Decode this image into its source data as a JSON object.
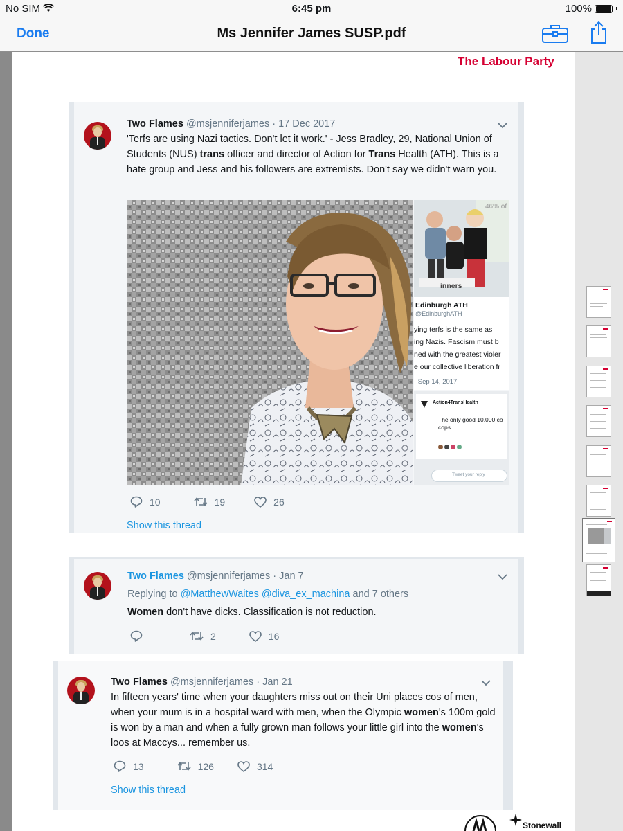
{
  "status": {
    "carrier": "No SIM",
    "time": "6:45 pm",
    "battery": "100%"
  },
  "nav": {
    "done": "Done",
    "title": "Ms Jennifer James SUSP.pdf",
    "tools_icon": "toolbox-icon",
    "share_icon": "share-icon"
  },
  "page": {
    "header": "The Labour Party",
    "footer_stonewall": "Stonewall",
    "footer_badge_icon": "positive-about-people-logo"
  },
  "tweets": [
    {
      "name": "Two Flames",
      "handle": "@msjenniferjames",
      "date": "· 17 Dec 2017",
      "text_parts": [
        "'Terfs are using Nazi tactics. Don't let it work.' - Jess Bradley, 29, National Union of Students (NUS) ",
        "trans",
        " officer and director of Action for ",
        "Trans",
        " Health (ATH). This is a hate group and Jess and his followers are extremists. Don't say we didn't warn you."
      ],
      "media_side": {
        "account": "Edinburgh ATH",
        "handle": "@EdinburghATH",
        "lines": [
          "ying terfs is the same as",
          "ing Nazis. Fascism must b",
          "ned with the greatest violer",
          "e our collective liberation fr"
        ],
        "date": "· Sep 14, 2017",
        "poster": "46% of p",
        "banner": "inners"
      },
      "media_side2": {
        "account": "Action4TransHealth",
        "lines": [
          "The only good 10,000 co",
          "cops"
        ],
        "reply_placeholder": "Tweet your reply"
      },
      "replies": "10",
      "retweets": "19",
      "likes": "26",
      "thread": "Show this thread"
    },
    {
      "name": "Two Flames",
      "handle": "@msjenniferjames",
      "date": "· Jan 7",
      "reply_prefix": "Replying to ",
      "reply_users": "@MatthewWaites @diva_ex_machina",
      "reply_suffix": " and 7 others",
      "text_bold": "Women",
      "text_rest": " don't have dicks. Classification is not reduction.",
      "replies": "",
      "retweets": "2",
      "likes": "16"
    },
    {
      "name": "Two Flames",
      "handle": "@msjenniferjames",
      "date": "· Jan 21",
      "text_parts": [
        "In fifteen years' time when your daughters miss out on their Uni places cos of men, when your mum is in a hospital ward with men, when the Olympic ",
        "women",
        "'s 100m gold is won by a man and when a fully grown man follows your little girl into the ",
        "women",
        "'s loos at Maccys... remember us."
      ],
      "replies": "13",
      "retweets": "126",
      "likes": "314",
      "thread": "Show this thread"
    }
  ],
  "icons": {
    "reply": "reply-icon",
    "retweet": "retweet-icon",
    "like": "heart-icon",
    "menu": "chevron-down-icon"
  },
  "colors": {
    "accent": "#1a7cf0",
    "labour": "#d50032",
    "link": "#1b95e0",
    "meta": "#657786"
  }
}
